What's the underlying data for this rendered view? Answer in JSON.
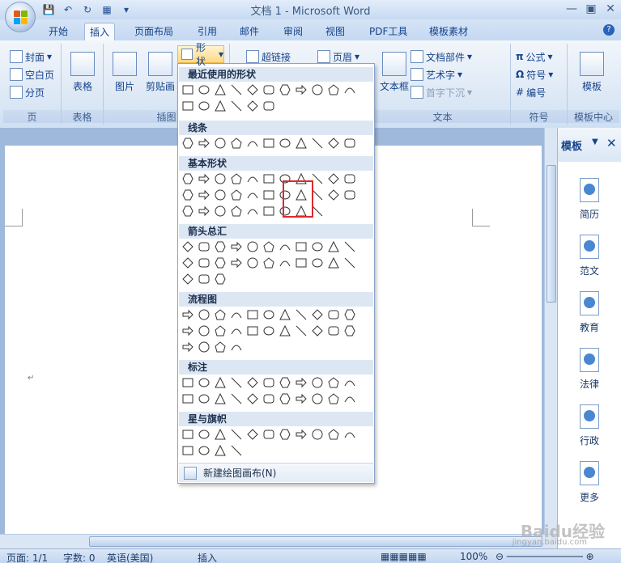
{
  "window": {
    "title": "文档 1 - Microsoft Word"
  },
  "tabs": [
    "开始",
    "插入",
    "页面布局",
    "引用",
    "邮件",
    "审阅",
    "视图",
    "PDF工具",
    "模板素材"
  ],
  "active_tab": "插入",
  "ribbon": {
    "page_group": {
      "label": "页",
      "cover": "封面",
      "blank": "空白页",
      "pagebreak": "分页"
    },
    "table_group": {
      "label": "表格",
      "table": "表格"
    },
    "illus_group": {
      "label": "插图",
      "picture": "图片",
      "clipart": "剪贴画",
      "shapes": "形状"
    },
    "links_group": {
      "hyperlink": "超链接"
    },
    "header_group": {
      "header": "页眉"
    },
    "text_group": {
      "label": "文本",
      "textbox": "文本框",
      "docparts": "文档部件",
      "wordart": "艺术字",
      "dropcap": "首字下沉"
    },
    "symbol_group": {
      "label": "符号",
      "equation": "公式",
      "symbol": "符号",
      "number": "编号"
    },
    "template_group": {
      "label": "模板中心",
      "template": "模板"
    }
  },
  "shapes_menu": {
    "recent": "最近使用的形状",
    "lines": "线条",
    "basic": "基本形状",
    "arrows": "箭头总汇",
    "flowchart": "流程图",
    "callouts": "标注",
    "stars": "星与旗帜",
    "new_canvas": "新建绘图画布(N)"
  },
  "pane": {
    "title": "模板",
    "items": [
      "简历",
      "范文",
      "教育",
      "法律",
      "行政",
      "更多"
    ]
  },
  "status": {
    "page": "页面: 1/1",
    "words": "字数: 0",
    "lang": "英语(美国)",
    "mode": "插入",
    "zoom": "100%"
  },
  "watermark": {
    "brand": "Baidu经验",
    "url": "jingyan.baidu.com"
  }
}
